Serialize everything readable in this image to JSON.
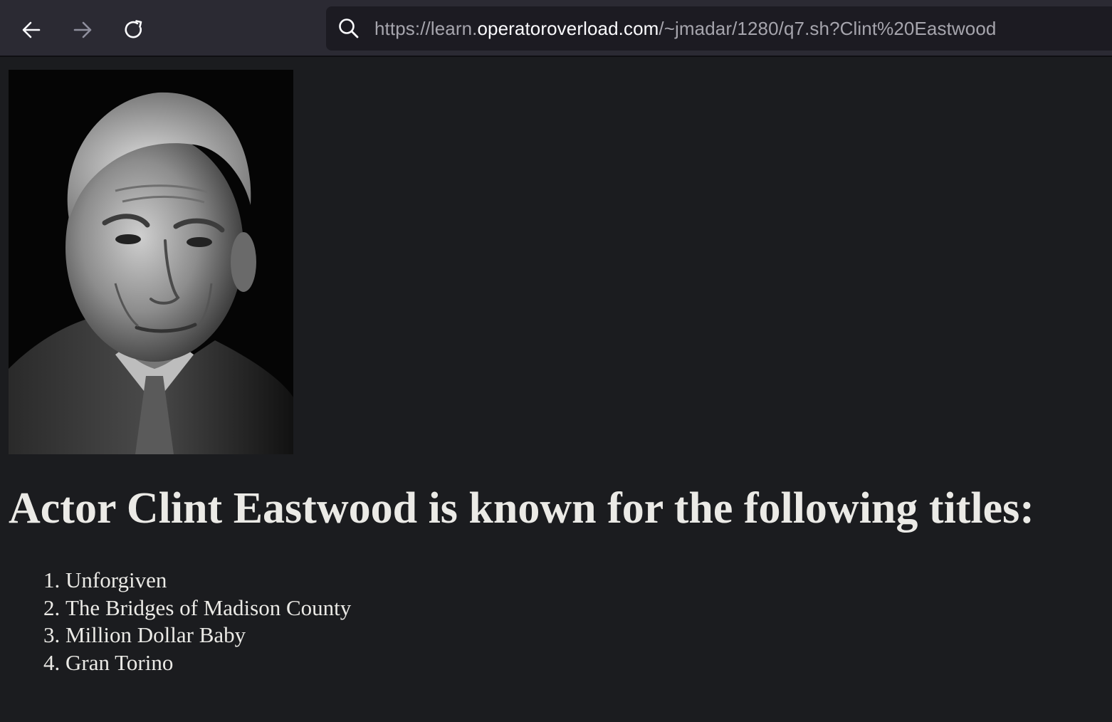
{
  "browser": {
    "url": {
      "prefix": "https://learn.",
      "domain": "operatoroverload.com",
      "suffix": "/~jmadar/1280/q7.sh?Clint%20Eastwood"
    },
    "icons": {
      "back": "back-arrow-icon",
      "forward": "forward-arrow-icon",
      "reload": "reload-icon",
      "search": "search-icon"
    }
  },
  "page": {
    "heading": "Actor Clint Eastwood is known for the following titles:",
    "titles": [
      "Unforgiven",
      "The Bridges of Madison County",
      "Million Dollar Baby",
      "Gran Torino"
    ]
  },
  "colors": {
    "toolbar": "#2b2a33",
    "url_bar": "#1c1b22",
    "page_background": "#1b1c1f",
    "text": "#ebeae6"
  }
}
